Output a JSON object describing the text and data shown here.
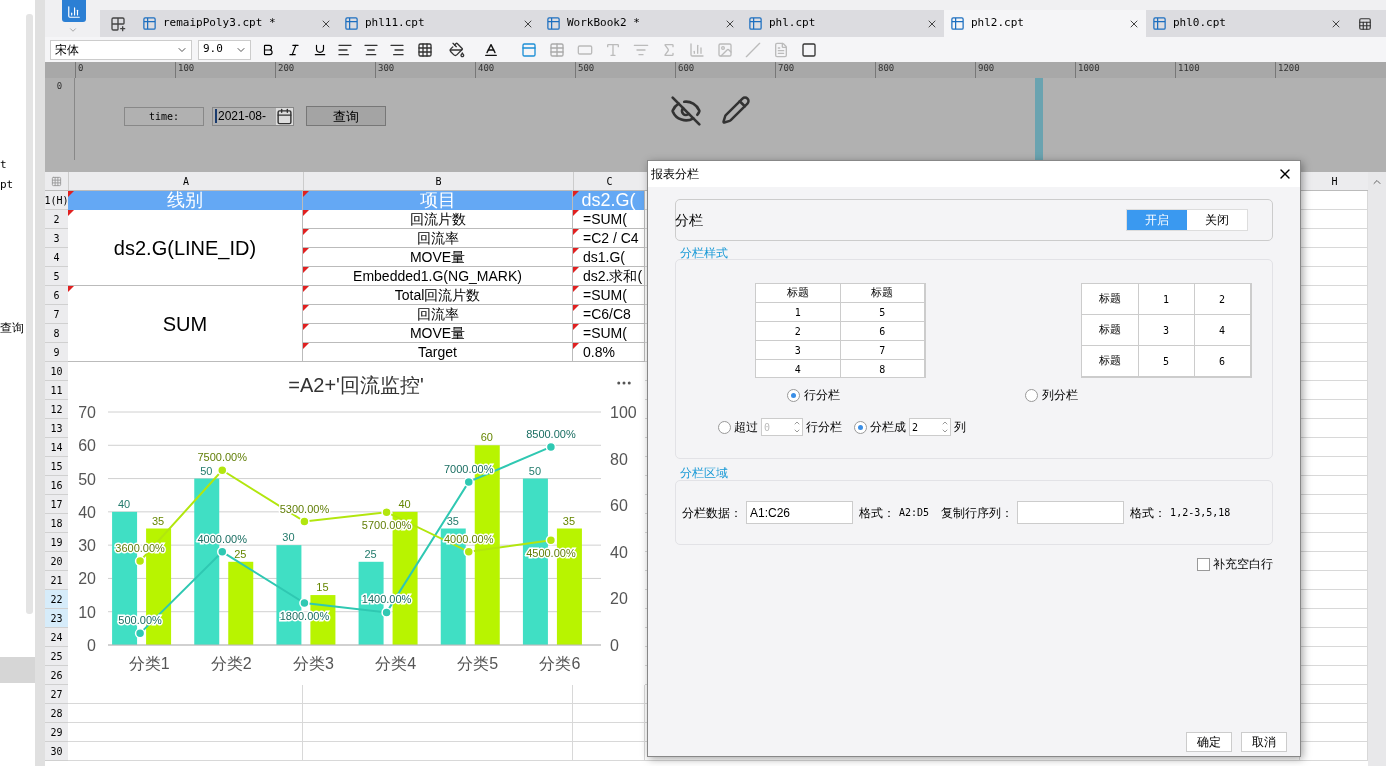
{
  "left_panel": {
    "items": [
      "t",
      "pt",
      "查询"
    ]
  },
  "tabs": [
    {
      "label": "remaipPoly3.cpt *",
      "selected": false
    },
    {
      "label": "phl11.cpt",
      "selected": false
    },
    {
      "label": "WorkBook2 *",
      "selected": false
    },
    {
      "label": "phl.cpt",
      "selected": false
    },
    {
      "label": "phl2.cpt",
      "selected": true
    },
    {
      "label": "phl0.cpt",
      "selected": false
    }
  ],
  "toolbar": {
    "font": "宋体",
    "size": "9.0"
  },
  "ruler": {
    "marks": [
      "0",
      "100",
      "200",
      "300",
      "400",
      "500",
      "600",
      "700",
      "800",
      "900",
      "1000",
      "1100",
      "1200"
    ],
    "vertical_mark": "0"
  },
  "parameter_pane": {
    "label": "time:",
    "date_value": "2021-08-",
    "query_button": "查询"
  },
  "sheet": {
    "columns": [
      "A",
      "B",
      "C",
      "H"
    ],
    "row_numbers": [
      {
        "label": "1(H)",
        "selected": false
      },
      {
        "label": "2",
        "selected": false
      },
      {
        "label": "3",
        "selected": false
      },
      {
        "label": "4",
        "selected": false
      },
      {
        "label": "5",
        "selected": false
      },
      {
        "label": "6",
        "selected": false
      },
      {
        "label": "7",
        "selected": false
      },
      {
        "label": "8",
        "selected": false
      },
      {
        "label": "9",
        "selected": false
      },
      {
        "label": "10",
        "selected": false
      },
      {
        "label": "11",
        "selected": false
      },
      {
        "label": "12",
        "selected": false
      },
      {
        "label": "13",
        "selected": false
      },
      {
        "label": "14",
        "selected": false
      },
      {
        "label": "15",
        "selected": false
      },
      {
        "label": "16",
        "selected": false
      },
      {
        "label": "17",
        "selected": false
      },
      {
        "label": "18",
        "selected": false
      },
      {
        "label": "19",
        "selected": false
      },
      {
        "label": "20",
        "selected": false
      },
      {
        "label": "21",
        "selected": false
      },
      {
        "label": "22",
        "selected": true
      },
      {
        "label": "23",
        "selected": true
      },
      {
        "label": "24",
        "selected": false
      },
      {
        "label": "25",
        "selected": false
      },
      {
        "label": "26",
        "selected": false
      },
      {
        "label": "27",
        "selected": false
      },
      {
        "label": "28",
        "selected": false
      },
      {
        "label": "29",
        "selected": false
      },
      {
        "label": "30",
        "selected": false
      }
    ],
    "header_cells": [
      "线别",
      "项目",
      "ds2.G("
    ],
    "groups": [
      {
        "label": "ds2.G(LINE_ID)",
        "rows": [
          {
            "item": "回流片数",
            "value": "=SUM("
          },
          {
            "item": "回流率",
            "value": "=C2 / C4"
          },
          {
            "item": "MOVE量",
            "value": "ds1.G("
          },
          {
            "item": "Embedded1.G(NG_MARK)",
            "value": "ds2.求和("
          }
        ]
      },
      {
        "label": "SUM",
        "rows": [
          {
            "item": "Total回流片数",
            "value": "=SUM("
          },
          {
            "item": "回流率",
            "value": "=C6/C8"
          },
          {
            "item": "MOVE量",
            "value": "=SUM("
          },
          {
            "item": "Target",
            "value": "0.8%"
          }
        ]
      }
    ],
    "chart_data": {
      "type": "bar",
      "title": "=A2+'回流监控'",
      "categories": [
        "分类1",
        "分类2",
        "分类3",
        "分类4",
        "分类5",
        "分类6"
      ],
      "series": [
        {
          "type": "bar",
          "color": "#40dfc4",
          "values": [
            40,
            50,
            30,
            25,
            35,
            50
          ],
          "value_labels": [
            "40",
            "50",
            "30",
            "25",
            "35",
            "50"
          ]
        },
        {
          "type": "bar",
          "color": "#b8f400",
          "values": [
            35,
            25,
            15,
            40,
            60,
            35
          ],
          "value_labels": [
            "35",
            "25",
            "15",
            "40",
            "60",
            "35"
          ]
        },
        {
          "type": "line",
          "axis": "y2",
          "marker": true,
          "color": "#2fc8b2",
          "values": [
            5,
            40,
            18,
            14,
            70,
            85
          ],
          "value_labels": [
            "500.00%",
            "4000.00%",
            "1800.00%",
            "1400.00%",
            "7000.00%",
            "8500.00%"
          ]
        },
        {
          "type": "line",
          "axis": "y2",
          "marker": true,
          "color": "#b2e60e",
          "values": [
            36,
            75,
            53,
            57,
            40,
            45
          ],
          "value_labels": [
            "3600.00%",
            "7500.00%",
            "5300.00%",
            "5700.00%",
            "4000.00%",
            "4500.00%"
          ]
        }
      ],
      "ylim": [
        0,
        70
      ],
      "yticks": [
        0,
        10,
        20,
        30,
        40,
        50,
        60,
        70
      ],
      "y2lim": [
        0,
        100
      ],
      "y2ticks": [
        0,
        20,
        40,
        60,
        80,
        100
      ],
      "grid": true,
      "data_labels": true
    }
  },
  "dialog": {
    "title": "报表分栏",
    "toggle": {
      "label": "分栏",
      "options": [
        {
          "label": "开启",
          "selected": true
        },
        {
          "label": "关闭",
          "selected": false
        }
      ]
    },
    "style_section": {
      "legend": "分栏样式",
      "row_preview": {
        "header": [
          "标题",
          "标题"
        ],
        "rows": [
          [
            "1",
            "5"
          ],
          [
            "2",
            "6"
          ],
          [
            "3",
            "7"
          ],
          [
            "4",
            "8"
          ]
        ]
      },
      "column_preview": {
        "rows": [
          [
            "标题",
            "1",
            "2"
          ],
          [
            "标题",
            "3",
            "4"
          ],
          [
            "标题",
            "5",
            "6"
          ]
        ]
      },
      "layout_options": [
        {
          "label": "行分栏",
          "selected": true
        },
        {
          "label": "列分栏",
          "selected": false
        }
      ],
      "split_options": [
        {
          "prefix": "超过",
          "value": "0",
          "suffix": "行分栏",
          "selected": false
        },
        {
          "prefix": "分栏成",
          "value": "2",
          "suffix": "列",
          "selected": true
        }
      ]
    },
    "area_section": {
      "legend": "分栏区域",
      "data_label": "分栏数据：",
      "data_value": "A1:C26",
      "format_label_1": "格式：",
      "format_hint_1": "A2:D5",
      "copy_label": "复制行序列：",
      "format_label_2": "格式：",
      "format_hint_2": "1,2-3,5,18"
    },
    "fill_blank": {
      "label": "补充空白行",
      "checked": false
    },
    "buttons": [
      "确定",
      "取消"
    ]
  }
}
